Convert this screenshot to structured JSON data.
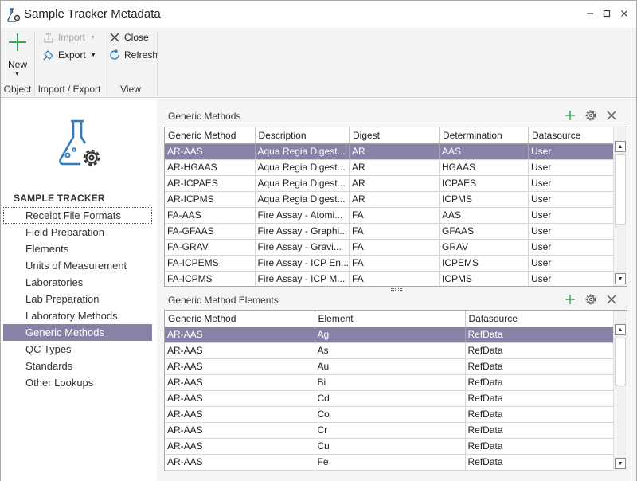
{
  "window": {
    "title": "Sample Tracker Metadata",
    "controls": {
      "minimize": "—",
      "maximize": "☐",
      "close": "✕"
    }
  },
  "ribbon": {
    "groups": [
      {
        "label": "Object"
      },
      {
        "label": "Import / Export"
      },
      {
        "label": "View"
      }
    ],
    "new_label": "New",
    "import_label": "Import",
    "export_label": "Export",
    "close_label": "Close",
    "refresh_label": "Refresh"
  },
  "nav": {
    "section_title": "SAMPLE TRACKER",
    "items": [
      "Receipt File Formats",
      "Field Preparation",
      "Elements",
      "Units of Measurement",
      "Laboratories",
      "Lab Preparation",
      "Laboratory Methods",
      "Generic Methods",
      "QC Types",
      "Standards",
      "Other Lookups"
    ],
    "active_index": 7,
    "focused_index": 0
  },
  "methods_panel": {
    "title": "Generic Methods",
    "columns": [
      "Generic Method",
      "Description",
      "Digest",
      "Determination",
      "Datasource"
    ],
    "rows": [
      [
        "AR-AAS",
        "Aqua Regia Digest...",
        "AR",
        "AAS",
        "User"
      ],
      [
        "AR-HGAAS",
        "Aqua Regia Digest...",
        "AR",
        "HGAAS",
        "User"
      ],
      [
        "AR-ICPAES",
        "Aqua Regia Digest...",
        "AR",
        "ICPAES",
        "User"
      ],
      [
        "AR-ICPMS",
        "Aqua Regia Digest...",
        "AR",
        "ICPMS",
        "User"
      ],
      [
        "FA-AAS",
        "Fire Assay - Atomi...",
        "FA",
        "AAS",
        "User"
      ],
      [
        "FA-GFAAS",
        "Fire Assay - Graphi...",
        "FA",
        "GFAAS",
        "User"
      ],
      [
        "FA-GRAV",
        "Fire Assay - Gravi...",
        "FA",
        "GRAV",
        "User"
      ],
      [
        "FA-ICPEMS",
        "Fire Assay - ICP En...",
        "FA",
        "ICPEMS",
        "User"
      ],
      [
        "FA-ICPMS",
        "Fire Assay - ICP M...",
        "FA",
        "ICPMS",
        "User"
      ]
    ],
    "selected_row": 0
  },
  "elements_panel": {
    "title": "Generic Method Elements",
    "columns": [
      "Generic Method",
      "Element",
      "Datasource"
    ],
    "rows": [
      [
        "AR-AAS",
        "Ag",
        "RefData"
      ],
      [
        "AR-AAS",
        "As",
        "RefData"
      ],
      [
        "AR-AAS",
        "Au",
        "RefData"
      ],
      [
        "AR-AAS",
        "Bi",
        "RefData"
      ],
      [
        "AR-AAS",
        "Cd",
        "RefData"
      ],
      [
        "AR-AAS",
        "Co",
        "RefData"
      ],
      [
        "AR-AAS",
        "Cr",
        "RefData"
      ],
      [
        "AR-AAS",
        "Cu",
        "RefData"
      ],
      [
        "AR-AAS",
        "Fe",
        "RefData"
      ]
    ],
    "selected_row": 0
  },
  "icons": [
    "app-icon",
    "plus-icon",
    "import-icon",
    "export-icon",
    "close-x-icon",
    "refresh-icon",
    "flask-gear-icon",
    "gear-icon",
    "chevron-up-icon",
    "chevron-down-icon"
  ],
  "colors": {
    "accent_selected": "#8a82a6",
    "add_green": "#3aa757",
    "icon_blue": "#2f7dc1"
  }
}
